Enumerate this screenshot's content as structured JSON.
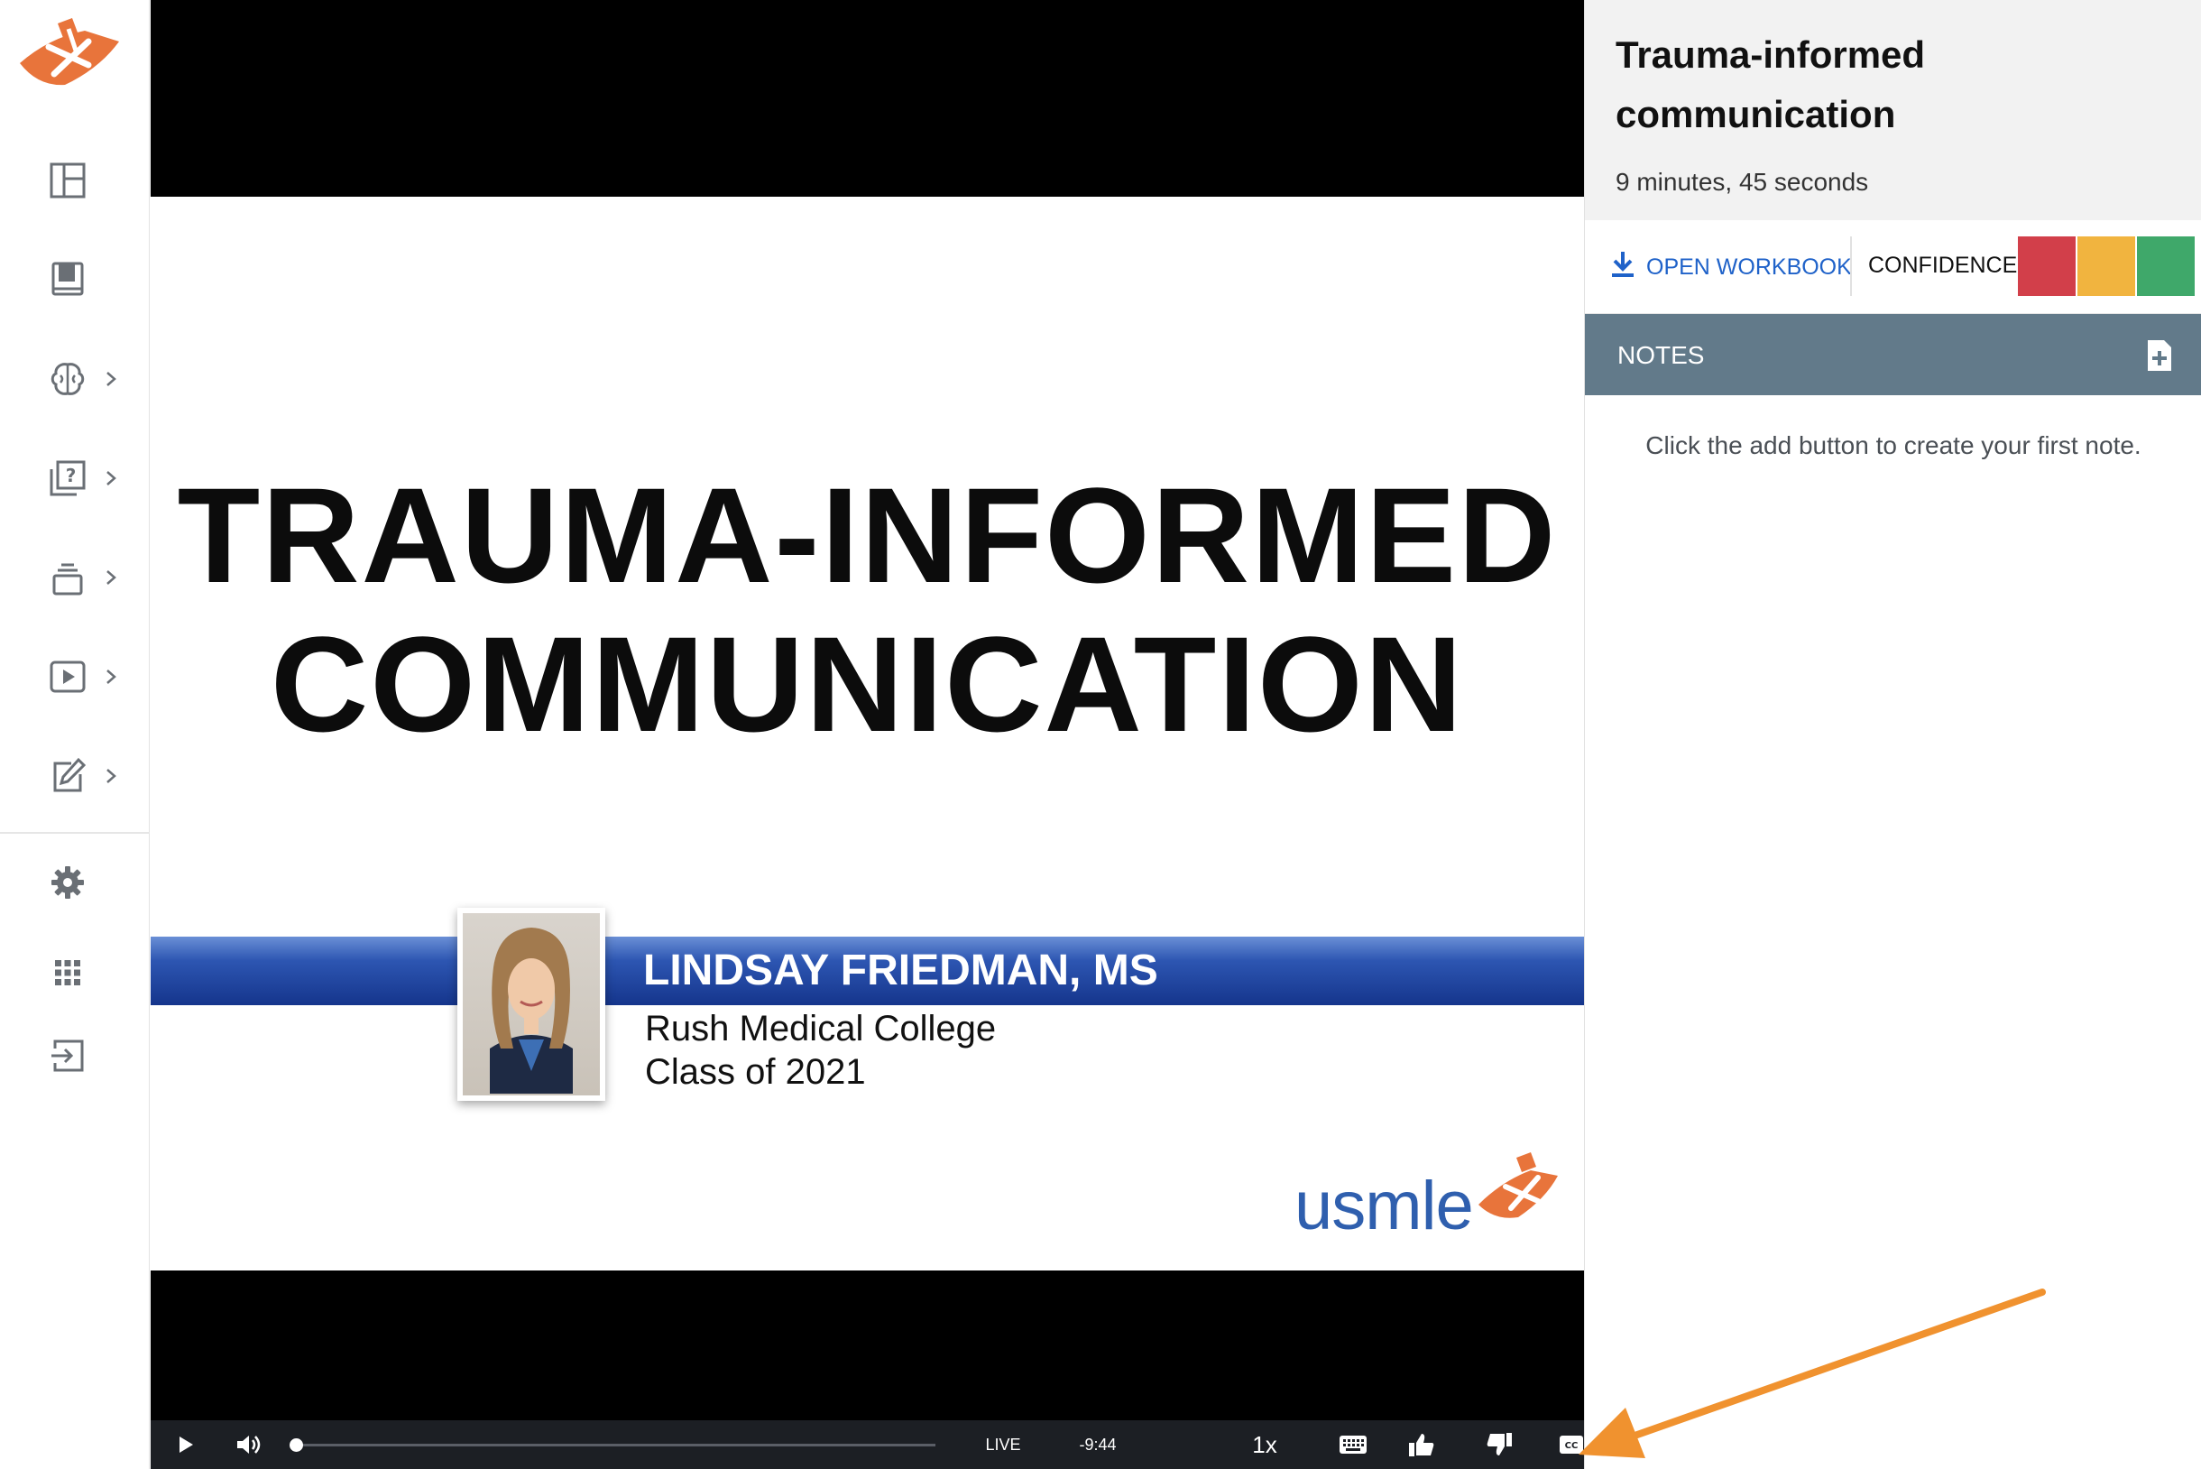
{
  "sidebar": {
    "logo": "brand-logo",
    "items": [
      {
        "name": "dashboard-icon",
        "has_chevron": false
      },
      {
        "name": "book-icon",
        "has_chevron": false
      },
      {
        "name": "brain-icon",
        "has_chevron": true
      },
      {
        "name": "question-bank-icon",
        "has_chevron": true
      },
      {
        "name": "flashcards-icon",
        "has_chevron": true
      },
      {
        "name": "video-icon",
        "has_chevron": true
      },
      {
        "name": "edit-icon",
        "has_chevron": true
      },
      {
        "name": "gear-icon",
        "has_chevron": false
      },
      {
        "name": "apps-grid-icon",
        "has_chevron": false
      },
      {
        "name": "logout-icon",
        "has_chevron": false
      }
    ]
  },
  "video": {
    "slide": {
      "title_line1": "TRAUMA-INFORMED",
      "title_line2": "COMMUNICATION",
      "speaker_name": "LINDSAY FRIEDMAN, MS",
      "speaker_affiliation": "Rush Medical College",
      "speaker_class": "Class of 2021",
      "brand": "usmle"
    },
    "controls": {
      "live_label": "LIVE",
      "time_remaining": "-9:44",
      "playback_rate": "1x",
      "progress": 0
    }
  },
  "panel": {
    "lesson_title": "Trauma-informed communication",
    "duration": "9 minutes, 45 seconds",
    "open_workbook_label": "OPEN WORKBOOK",
    "confidence_label": "CONFIDENCE",
    "confidence_colors": [
      "#d23f4a",
      "#f1b43f",
      "#3fa86a"
    ],
    "notes_label": "NOTES",
    "notes_empty_text": "Click the add button to create your first note."
  },
  "colors": {
    "accent_blue": "#1f62c9",
    "notes_bar": "#627a8a",
    "brand_orange": "#e8743b",
    "annotation_arrow": "#f0922f"
  }
}
